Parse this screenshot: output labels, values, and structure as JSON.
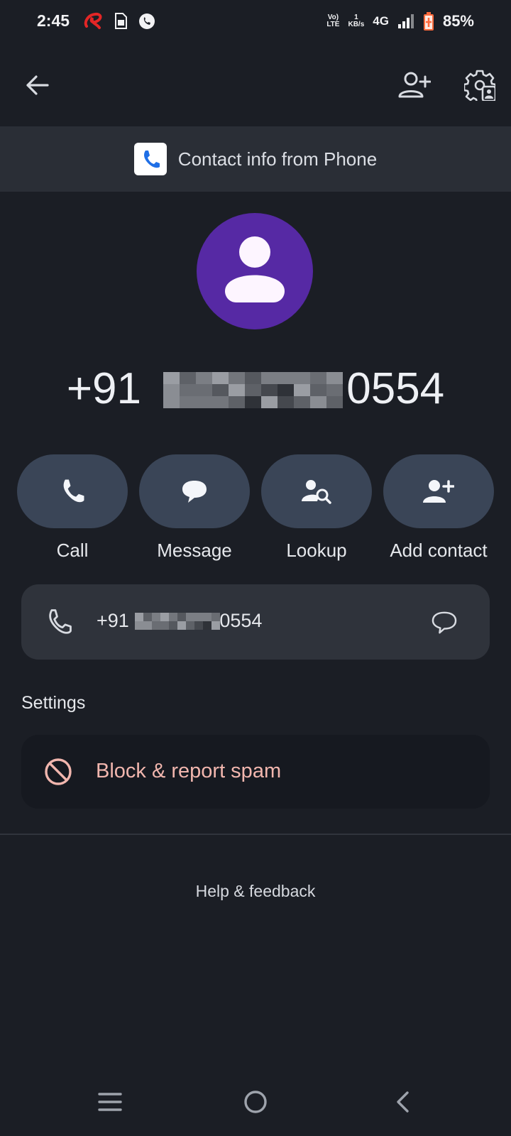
{
  "status_bar": {
    "time": "2:45",
    "volte_top": "Vo)",
    "volte_bottom": "LTE",
    "speed_top": "1",
    "speed_bottom": "KB/s",
    "network": "4G",
    "battery": "85%"
  },
  "app_bar": {
    "back_icon": "arrow-left-icon",
    "add_contact_icon": "person-add-icon",
    "settings_icon": "gear-person-icon"
  },
  "banner": {
    "text": "Contact info from Phone",
    "app_icon": "phone-app-icon"
  },
  "contact": {
    "number_prefix": "+91",
    "number_suffix": "0554"
  },
  "actions": [
    {
      "label": "Call",
      "icon": "phone-icon"
    },
    {
      "label": "Message",
      "icon": "message-bubble-icon"
    },
    {
      "label": "Lookup",
      "icon": "person-search-icon"
    },
    {
      "label": "Add contact",
      "icon": "person-add-icon"
    }
  ],
  "phone_card": {
    "number_prefix": "+91",
    "number_suffix": "0554",
    "phone_icon": "phone-outline-icon",
    "message_icon": "message-outline-icon"
  },
  "settings": {
    "heading": "Settings",
    "block_label": "Block & report spam"
  },
  "help": {
    "label": "Help & feedback"
  },
  "colors": {
    "background": "#1b1e25",
    "avatar": "#5629a4",
    "action_pill": "#3a4557",
    "block_text": "#f1b6ae"
  }
}
